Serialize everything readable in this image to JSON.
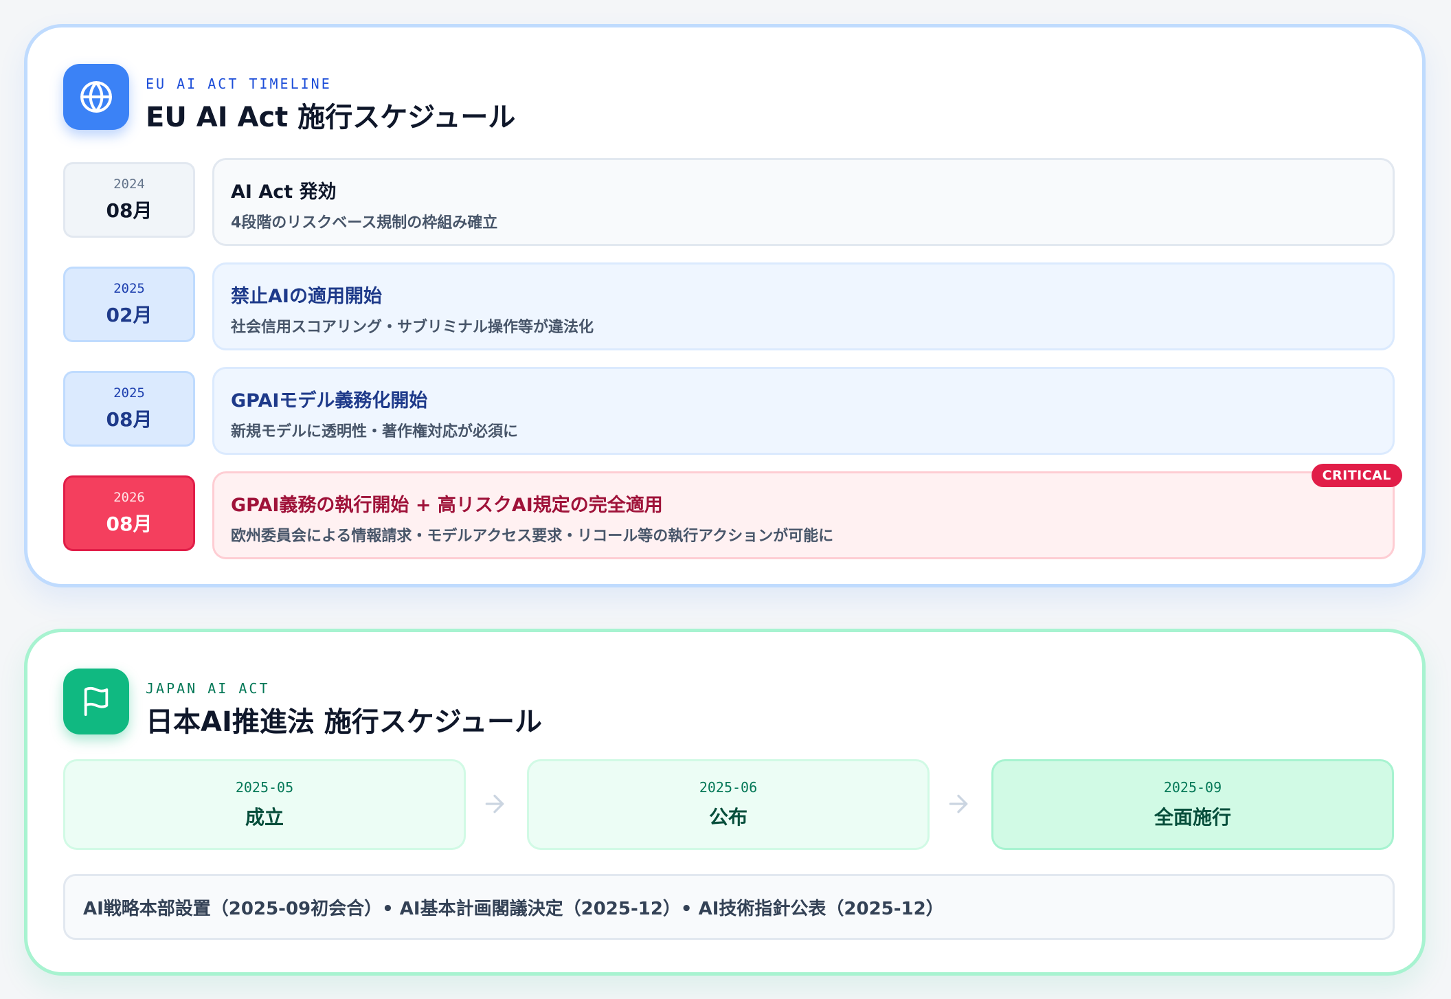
{
  "eu": {
    "eyebrow": "EU AI ACT TIMELINE",
    "title": "EU AI Act 施行スケジュール",
    "icon": "globe-icon",
    "accent": "#3b82f6",
    "events": [
      {
        "year": "2024",
        "month": "08月",
        "title": "AI Act 発効",
        "desc": "4段階のリスクベース規制の枠組み確立"
      },
      {
        "year": "2025",
        "month": "02月",
        "title": "禁止AIの適用開始",
        "desc": "社会信用スコアリング・サブリミナル操作等が違法化"
      },
      {
        "year": "2025",
        "month": "08月",
        "title": "GPAIモデル義務化開始",
        "desc": "新規モデルに透明性・著作権対応が必須に"
      },
      {
        "year": "2026",
        "month": "08月",
        "title": "GPAI義務の執行開始 + 高リスクAI規定の完全適用",
        "desc": "欧州委員会による情報請求・モデルアクセス要求・リコール等の執行アクションが可能に",
        "badge": "CRITICAL"
      }
    ]
  },
  "jp": {
    "eyebrow": "JAPAN AI ACT",
    "title": "日本AI推進法 施行スケジュール",
    "icon": "flag-icon",
    "accent": "#10b981",
    "steps": [
      {
        "date": "2025-05",
        "label": "成立"
      },
      {
        "date": "2025-06",
        "label": "公布"
      },
      {
        "date": "2025-09",
        "label": "全面施行"
      }
    ],
    "note": "AI戦略本部設置（2025-09初会合）• AI基本計画閣議決定（2025-12）• AI技術指針公表（2025-12）"
  }
}
